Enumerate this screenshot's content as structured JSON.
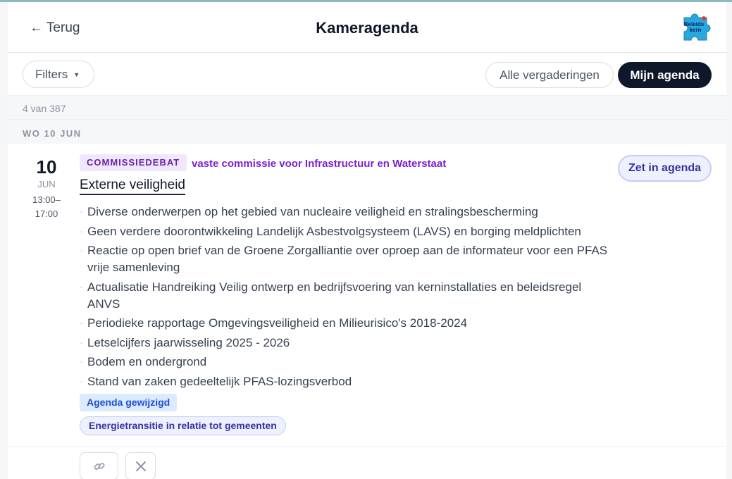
{
  "header": {
    "back_label": "← Terug",
    "title": "Kameragenda",
    "logo_icon": "beleidskern-puzzle-logo",
    "logo_text_1": "Beleids",
    "logo_text_2": "kern"
  },
  "toolbar": {
    "filters_label": "Filters",
    "all_label": "Alle vergaderingen",
    "mine_label": "Mijn agenda"
  },
  "results": {
    "count_text": "4 van 387"
  },
  "day_group": {
    "label": "WO 10 JUN"
  },
  "event": {
    "date_day": "10",
    "date_month": "JUN",
    "time_start": "13:00–",
    "time_end": "17:00",
    "type": "COMMISSIEDEBAT",
    "committee": "vaste commissie voor Infrastructuur en Waterstaat",
    "title": "Externe veiligheid",
    "add_label": "Zet in agenda",
    "items": [
      "Diverse onderwerpen op het gebied van nucleaire veiligheid en stralingsbescherming",
      "Geen verdere doorontwikkeling Landelijk Asbestvolgsysteem (LAVS) en borging meldplichten",
      "Reactie op open brief van de Groene Zorgalliantie over oproep aan de informateur voor een PFAS vrije samenleving",
      "Actualisatie Handreiking Veilig ontwerp en bedrijfsvoering van kerninstallaties en beleidsregel ANVS",
      "Periodieke rapportage Omgevingsveiligheid en Milieurisico's 2018-2024",
      "Letselcijfers jaarwisseling 2025 - 2026",
      "Bodem en ondergrond",
      "Stand van zaken gedeeltelijk PFAS-lozingsverbod"
    ],
    "status_badge": "Agenda gewijzigd",
    "topic": "Energietransitie in relatie tot gemeenten"
  },
  "actions": {
    "link_icon": "link-icon",
    "remove_icon": "close-icon"
  },
  "colors": {
    "primary_dark": "#0f172a",
    "purple_badge": "#6b21a8",
    "indigo_accent": "#3730a3",
    "blue_badge": "#1d4ed8"
  }
}
